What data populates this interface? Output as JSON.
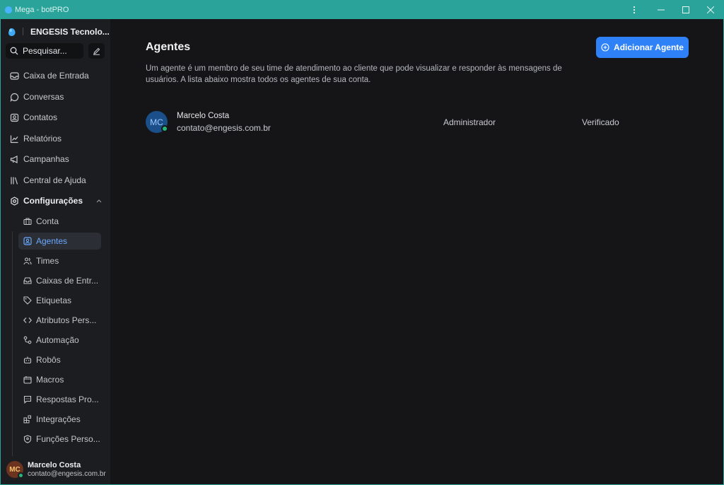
{
  "window": {
    "title": "Mega - botPRO"
  },
  "sidebar": {
    "workspace_name": "ENGESIS Tecnolo...",
    "search_label": "Pesquisar...",
    "nav": [
      {
        "label": "Caixa de Entrada",
        "icon": "inbox-icon"
      },
      {
        "label": "Conversas",
        "icon": "chat-bubble-icon"
      },
      {
        "label": "Contatos",
        "icon": "contact-card-icon"
      },
      {
        "label": "Relatórios",
        "icon": "chart-line-icon"
      },
      {
        "label": "Campanhas",
        "icon": "megaphone-icon"
      },
      {
        "label": "Central de Ajuda",
        "icon": "library-icon"
      },
      {
        "label": "Configurações",
        "icon": "settings-gear-icon"
      }
    ],
    "settings_items": [
      {
        "label": "Conta",
        "icon": "briefcase-icon"
      },
      {
        "label": "Agentes",
        "icon": "person-square-icon"
      },
      {
        "label": "Times",
        "icon": "people-icon"
      },
      {
        "label": "Caixas de Entr...",
        "icon": "mail-inbox-icon"
      },
      {
        "label": "Etiquetas",
        "icon": "tag-icon"
      },
      {
        "label": "Atributos Pers...",
        "icon": "code-icon"
      },
      {
        "label": "Automação",
        "icon": "flow-icon"
      },
      {
        "label": "Robôs",
        "icon": "bot-icon"
      },
      {
        "label": "Macros",
        "icon": "macro-icon"
      },
      {
        "label": "Respostas Pro...",
        "icon": "canned-reply-icon"
      },
      {
        "label": "Integrações",
        "icon": "apps-icon"
      },
      {
        "label": "Funções Perso...",
        "icon": "shield-person-icon"
      }
    ],
    "active_item": "Agentes",
    "user": {
      "initials": "MC",
      "name": "Marcelo Costa",
      "email": "contato@engesis.com.br"
    }
  },
  "main": {
    "title": "Agentes",
    "description": "Um agente é um membro de seu time de atendimento ao cliente que pode visualizar e responder às mensagens de usuários. A lista abaixo mostra todos os agentes de sua conta.",
    "add_button_label": "Adicionar Agente",
    "agents": [
      {
        "initials": "MC",
        "name": "Marcelo Costa",
        "email": "contato@engesis.com.br",
        "role": "Administrador",
        "status": "Verificado"
      }
    ]
  },
  "colors": {
    "accent": "#2f81f7",
    "titlebar": "#2aa39a",
    "active_text": "#6aa8ff",
    "online": "#26b57a"
  }
}
